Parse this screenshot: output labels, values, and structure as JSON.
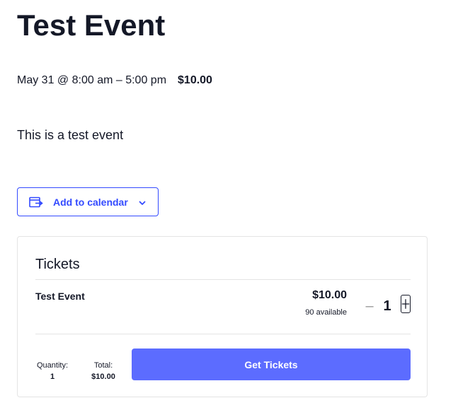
{
  "event": {
    "title": "Test Event",
    "datetime": "May 31 @ 8:00 am – 5:00 pm",
    "price": "$10.00",
    "description": "This is a test event"
  },
  "calendar": {
    "button_label": "Add to calendar",
    "icon": "calendar-export-icon",
    "dropdown_icon": "chevron-down-icon"
  },
  "tickets": {
    "heading": "Tickets",
    "items": [
      {
        "name": "Test Event",
        "price": "$10.00",
        "available": "90 available",
        "quantity": "1",
        "minus_glyph": "–"
      }
    ],
    "footer": {
      "quantity_label": "Quantity:",
      "quantity_value": "1",
      "total_label": "Total:",
      "total_value": "$10.00",
      "submit_label": "Get Tickets"
    }
  },
  "colors": {
    "accent": "#334aff",
    "button_bg": "#5c6cff",
    "text": "#141827",
    "border": "#e4e4e4",
    "muted": "#9a9a9a"
  }
}
